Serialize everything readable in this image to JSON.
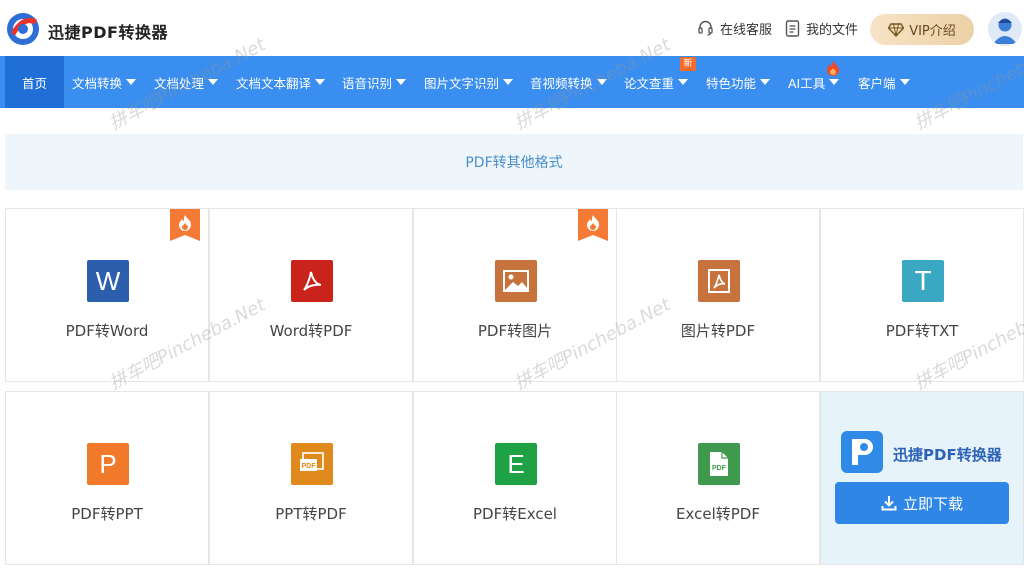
{
  "header": {
    "brand": "迅捷PDF转换器",
    "support_label": "在线客服",
    "files_label": "我的文件",
    "vip_label": "VIP介绍"
  },
  "nav": {
    "items": [
      {
        "label": "首页"
      },
      {
        "label": "文档转换"
      },
      {
        "label": "文档处理"
      },
      {
        "label": "文档文本翻译"
      },
      {
        "label": "语音识别"
      },
      {
        "label": "图片文字识别"
      },
      {
        "label": "音视频转换"
      },
      {
        "label": "论文查重"
      },
      {
        "label": "特色功能"
      },
      {
        "label": "AI工具"
      },
      {
        "label": "客户端"
      }
    ],
    "new_badge": "新"
  },
  "section": {
    "title": "PDF转其他格式"
  },
  "tools": [
    {
      "label": "PDF转Word",
      "color": "#2b5fad",
      "glyph": "W",
      "hot": true
    },
    {
      "label": "Word转PDF",
      "color": "#c9231b",
      "glyph": "pdf",
      "hot": false
    },
    {
      "label": "PDF转图片",
      "color": "#c8733e",
      "glyph": "img",
      "hot": true
    },
    {
      "label": "图片转PDF",
      "color": "#c8733e",
      "glyph": "pdf2",
      "hot": false
    },
    {
      "label": "PDF转TXT",
      "color": "#3aa7c3",
      "glyph": "T",
      "hot": false
    },
    {
      "label": "PDF转PPT",
      "color": "#f07a2a",
      "glyph": "P",
      "hot": false
    },
    {
      "label": "PPT转PDF",
      "color": "#e08a1e",
      "glyph": "PDF",
      "hot": false
    },
    {
      "label": "PDF转Excel",
      "color": "#1fa146",
      "glyph": "E",
      "hot": false
    },
    {
      "label": "Excel转PDF",
      "color": "#3f9a4d",
      "glyph": "PDF",
      "hot": false
    }
  ],
  "promo": {
    "name": "迅捷PDF转换器",
    "download_label": "立即下载"
  },
  "watermark": "拼车吧Pincheba.Net"
}
